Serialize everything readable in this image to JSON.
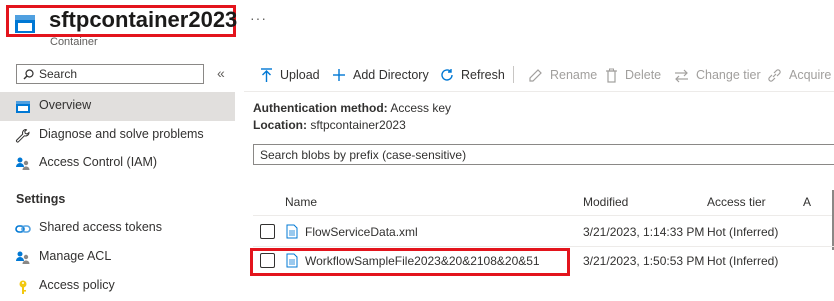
{
  "header": {
    "title": "sftpcontainer2023",
    "subtitle": "Container",
    "more": "···"
  },
  "sidebar": {
    "search_placeholder": "Search",
    "collapse": "«",
    "items": [
      {
        "label": "Overview",
        "icon": "container-icon",
        "selected": true
      },
      {
        "label": "Diagnose and solve problems",
        "icon": "wrench-icon"
      },
      {
        "label": "Access Control (IAM)",
        "icon": "people-icon"
      }
    ],
    "settings_title": "Settings",
    "settings_items": [
      {
        "label": "Shared access tokens",
        "icon": "link-icon"
      },
      {
        "label": "Manage ACL",
        "icon": "people-icon"
      },
      {
        "label": "Access policy",
        "icon": "key-icon"
      }
    ]
  },
  "toolbar": {
    "upload": "Upload",
    "add_directory": "Add Directory",
    "refresh": "Refresh",
    "rename": "Rename",
    "delete": "Delete",
    "change_tier": "Change tier",
    "acquire": "Acquire"
  },
  "info": {
    "auth_label": "Authentication method:",
    "auth_value": "Access key",
    "location_label": "Location:",
    "location_value": "sftpcontainer2023"
  },
  "blob_search": {
    "placeholder": "Search blobs by prefix (case-sensitive)"
  },
  "table": {
    "columns": [
      "Name",
      "Modified",
      "Access tier",
      "A"
    ],
    "rows": [
      {
        "name": "FlowServiceData.xml",
        "modified": "3/21/2023, 1:14:33 PM",
        "tier": "Hot (Inferred)"
      },
      {
        "name": "WorkflowSampleFile2023&20&2108&20&51",
        "modified": "3/21/2023, 1:50:53 PM",
        "tier": "Hot (Inferred)"
      }
    ]
  },
  "colors": {
    "accent": "#0078d4",
    "highlight": "#e3141c",
    "selected_bg": "#e1dfdd"
  }
}
